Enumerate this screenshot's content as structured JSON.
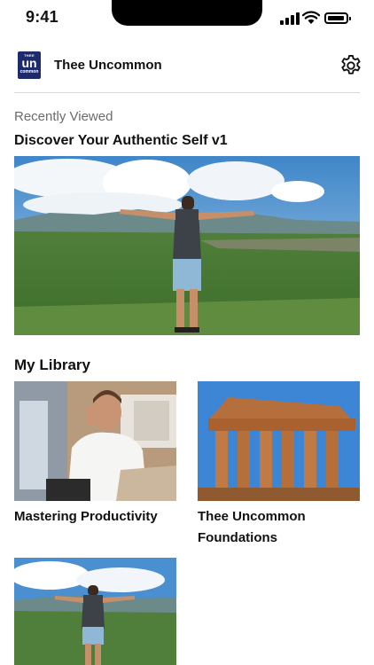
{
  "status_bar": {
    "time": "9:41",
    "icons": [
      "signal-icon",
      "wifi-icon",
      "battery-icon"
    ]
  },
  "header": {
    "logo": {
      "top_text": "THEE",
      "middle_text": "un",
      "bottom_text": "common"
    },
    "app_title": "Thee Uncommon",
    "settings_icon": "gear-icon"
  },
  "recently_viewed": {
    "label": "Recently Viewed",
    "item_title": "Discover Your Authentic Self v1",
    "image": "man-arms-outstretched-landscape"
  },
  "library": {
    "title": "My Library",
    "items": [
      {
        "title": "Mastering Productivity",
        "image": "man-on-phone-at-laptop"
      },
      {
        "title": "Thee Uncommon Foundations",
        "image": "greek-temple-ruins"
      },
      {
        "title": "",
        "image": "man-arms-outstretched-landscape"
      }
    ]
  },
  "colors": {
    "brand_navy": "#1d2a6b",
    "muted_text": "#6b6b6b",
    "divider": "#d9d9d9"
  }
}
